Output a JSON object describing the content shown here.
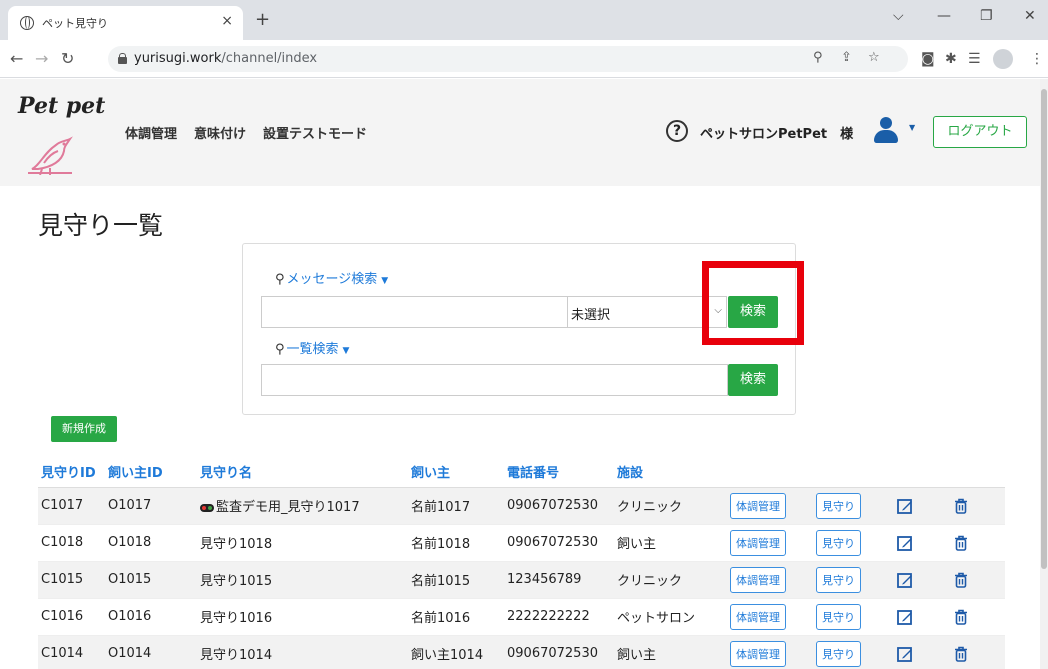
{
  "browser": {
    "tab_title": "ペット見守り",
    "tab_close": "×",
    "new_tab": "+",
    "url_host": "yurisugi.work",
    "url_path": "/channel/index",
    "window_controls": [
      "⌵",
      "—",
      "❐",
      "✕"
    ]
  },
  "header": {
    "logo": "Pet pet",
    "nav": [
      "体調管理",
      "意味付け",
      "設置テストモード"
    ],
    "help": "?",
    "salon": "ペットサロンPetPet　様",
    "logout": "ログアウト",
    "brand_color": "#28a745",
    "accent_color": "#e07a9a"
  },
  "main": {
    "title": "見守り一覧",
    "search": {
      "message_toggle": "メッセージ検索",
      "select_value": "未選択",
      "button": "検索",
      "list_toggle": "一覧検索",
      "button2": "検索"
    },
    "new_button": "新規作成",
    "table": {
      "headers": [
        "見守りID",
        "飼い主ID",
        "見守り名",
        "飼い主",
        "電話番号",
        "施設"
      ],
      "action_health": "体調管理",
      "action_watch": "見守り",
      "rows": [
        {
          "id": "C1017",
          "owner_id": "O1017",
          "name": "監査デモ用_見守り1017",
          "owner": "名前1017",
          "phone": "09067072530",
          "facility": "クリニック",
          "status_icon": true
        },
        {
          "id": "C1018",
          "owner_id": "O1018",
          "name": "見守り1018",
          "owner": "名前1018",
          "phone": "09067072530",
          "facility": "飼い主",
          "status_icon": false
        },
        {
          "id": "C1015",
          "owner_id": "O1015",
          "name": "見守り1015",
          "owner": "名前1015",
          "phone": "123456789",
          "facility": "クリニック",
          "status_icon": false
        },
        {
          "id": "C1016",
          "owner_id": "O1016",
          "name": "見守り1016",
          "owner": "名前1016",
          "phone": "2222222222",
          "facility": "ペットサロン",
          "status_icon": false
        },
        {
          "id": "C1014",
          "owner_id": "O1014",
          "name": "見守り1014",
          "owner": "飼い主1014",
          "phone": "09067072530",
          "facility": "飼い主",
          "status_icon": false
        }
      ]
    }
  }
}
